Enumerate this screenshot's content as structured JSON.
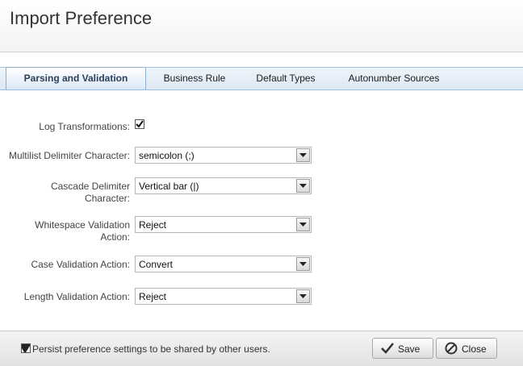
{
  "dialog": {
    "title": "Import Preference"
  },
  "tabs": [
    {
      "label": "Parsing and Validation",
      "active": true
    },
    {
      "label": "Business Rule",
      "active": false
    },
    {
      "label": "Default Types",
      "active": false
    },
    {
      "label": "Autonumber Sources",
      "active": false
    }
  ],
  "form": {
    "log_transformations": {
      "label": "Log Transformations:",
      "checked": true
    },
    "multilist_delimiter": {
      "label": "Multilist Delimiter Character:",
      "value": "semicolon (;)"
    },
    "cascade_delimiter": {
      "label_line1": "Cascade Delimiter",
      "label_line2": "Character:",
      "value": "Vertical bar (|)"
    },
    "whitespace_validation": {
      "label_line1": "Whitespace Validation",
      "label_line2": "Action:",
      "value": "Reject"
    },
    "case_validation": {
      "label": "Case Validation Action:",
      "value": "Convert"
    },
    "length_validation": {
      "label": "Length Validation Action:",
      "value": "Reject"
    }
  },
  "footer": {
    "persist_label": "Persist preference settings to be shared by other users.",
    "persist_checked": true,
    "save_label": "Save",
    "close_label": "Close"
  },
  "icons": {
    "save": "checkmark-icon",
    "close": "cancel-circle-icon",
    "dropdown": "dropdown-arrow-icon"
  }
}
